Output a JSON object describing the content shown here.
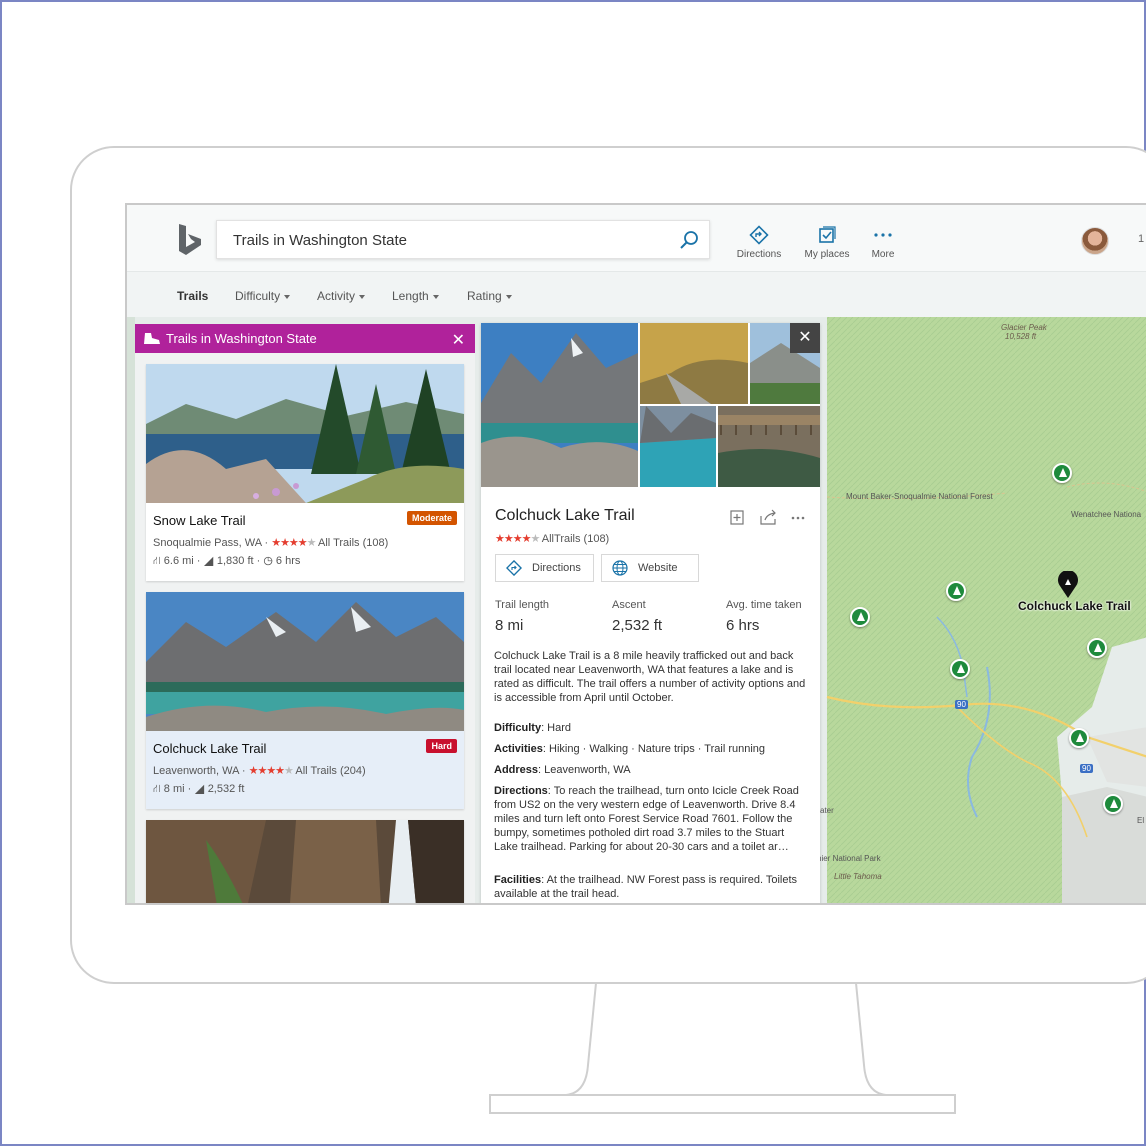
{
  "topbar": {
    "search_value": "Trails in Washington State",
    "directions_label": "Directions",
    "my_places_label": "My places",
    "more_label": "More",
    "user_number": "1"
  },
  "filters": {
    "trails": "Trails",
    "difficulty": "Difficulty",
    "activity": "Activity",
    "length": "Length",
    "rating": "Rating"
  },
  "list": {
    "header": "Trails in Washington State",
    "cards": [
      {
        "name": "Snow Lake Trail",
        "badge": "Moderate",
        "badge_color": "#d35400",
        "location": "Snoqualmie Pass, WA ·",
        "stars": 4,
        "reviews": "All Trails (108)",
        "distance": "6.6 mi ·",
        "elevation": "1,830 ft ·",
        "time": "6 hrs"
      },
      {
        "name": "Colchuck Lake Trail",
        "badge": "Hard",
        "badge_color": "#c8102e",
        "location": "Leavenworth, WA ·",
        "stars": 4,
        "reviews": "All Trails (204)",
        "distance": "8 mi ·",
        "elevation": "2,532 ft"
      }
    ]
  },
  "detail": {
    "title": "Colchuck Lake Trail",
    "stars": 4,
    "reviews": "AllTrails (108)",
    "directions_button": "Directions",
    "website_button": "Website",
    "stats": [
      {
        "label": "Trail length",
        "value": "8 mi"
      },
      {
        "label": "Ascent",
        "value": "2,532 ft"
      },
      {
        "label": "Avg. time taken",
        "value": "6 hrs"
      }
    ],
    "description": "Colchuck Lake Trail is a 8 mile heavily trafficked out and back trail located near Leavenworth, WA that features a lake and is rated as difficult. The trail offers a number of activity options and is accessible from April until October.",
    "facts": {
      "difficulty_label": "Difficulty",
      "difficulty": ": Hard",
      "activities_label": "Activities",
      "activities": ": Hiking · Walking · Nature trips · Trail running",
      "address_label": "Address",
      "address": ": Leavenworth, WA",
      "directions_label": "Directions",
      "directions": ": To reach the trailhead, turn onto Icicle Creek Road from US2 on the very western edge of Leavenworth. Drive 8.4 miles and turn left onto Forest Service Road 7601. Follow the bumpy, sometimes potholed dirt road 3.7 miles to the Stuart Lake trailhead. Parking for about 20-30 cars and a toilet ar…",
      "facilities_label": "Facilities",
      "facilities": ": At the trailhead. NW Forest pass is required. Toilets available at the trail head."
    }
  },
  "map": {
    "selected_label": "Colchuck Lake Trail",
    "labels": {
      "glacier": "Glacier Peak",
      "glacier_elev": "10,528 ft",
      "forest": "Mount Baker-Snoqualmie National Forest",
      "wenatchee": "Wenatchee Nationa",
      "ater": "ater",
      "park": "nier National Park",
      "tahoma": "Little Tahoma",
      "el": "El",
      "hw90": "90",
      "hw90b": "90"
    }
  },
  "colors": {
    "accent_magenta": "#b0229b",
    "link_blue": "#0f6cbd",
    "pin_green": "#1e8a3c",
    "star_red": "#e43d2f"
  }
}
